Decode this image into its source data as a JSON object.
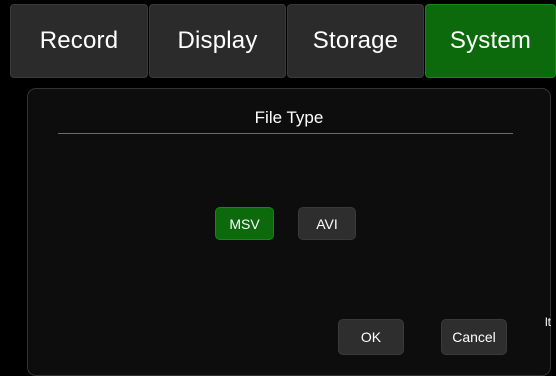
{
  "tabs": [
    {
      "label": "Record",
      "active": false
    },
    {
      "label": "Display",
      "active": false
    },
    {
      "label": "Storage",
      "active": false
    },
    {
      "label": "System",
      "active": true
    }
  ],
  "dialog": {
    "title": "File Type",
    "options": [
      {
        "label": "MSV",
        "selected": true
      },
      {
        "label": "AVI",
        "selected": false
      }
    ],
    "ok_label": "OK",
    "cancel_label": "Cancel"
  },
  "edge_fragment": "lt",
  "colors": {
    "accent_green": "#0c6a0c",
    "button_gray": "#2e2e2e",
    "background": "#000000"
  }
}
